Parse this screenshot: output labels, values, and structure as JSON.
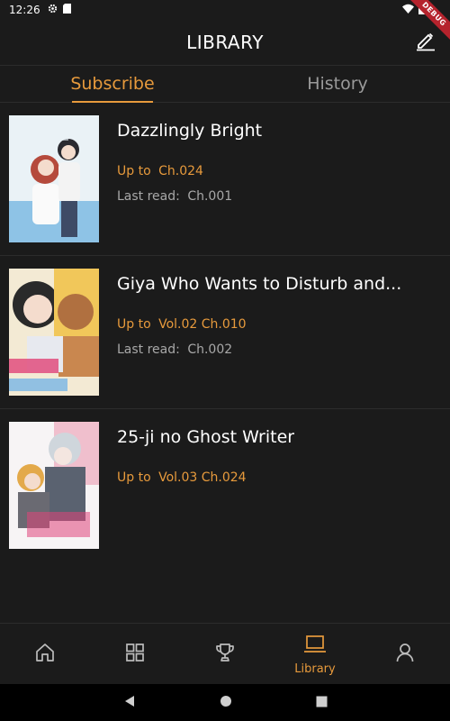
{
  "status_bar": {
    "time": "12:26"
  },
  "debug_banner": "DEBUG",
  "app_bar": {
    "title": "LIBRARY"
  },
  "tabs": [
    {
      "label": "Subscribe",
      "active": true
    },
    {
      "label": "History",
      "active": false
    }
  ],
  "library": [
    {
      "title": "Dazzlingly Bright",
      "up_to_label": "Up to",
      "up_to": "Ch.024",
      "last_read_label": "Last read:",
      "last_read": "Ch.001"
    },
    {
      "title": "Giya Who Wants to Disturb and...",
      "up_to_label": "Up to",
      "up_to": "Vol.02 Ch.010",
      "last_read_label": "Last read:",
      "last_read": "Ch.002"
    },
    {
      "title": "25-ji no Ghost Writer",
      "up_to_label": "Up to",
      "up_to": "Vol.03 Ch.024"
    }
  ],
  "bottom_nav": [
    {
      "icon": "home-icon",
      "label": ""
    },
    {
      "icon": "grid-icon",
      "label": ""
    },
    {
      "icon": "trophy-icon",
      "label": ""
    },
    {
      "icon": "laptop-icon",
      "label": "Library",
      "active": true
    },
    {
      "icon": "person-icon",
      "label": ""
    }
  ],
  "colors": {
    "accent": "#e79a3c",
    "background": "#1b1b1b",
    "debug": "#b5232d"
  }
}
